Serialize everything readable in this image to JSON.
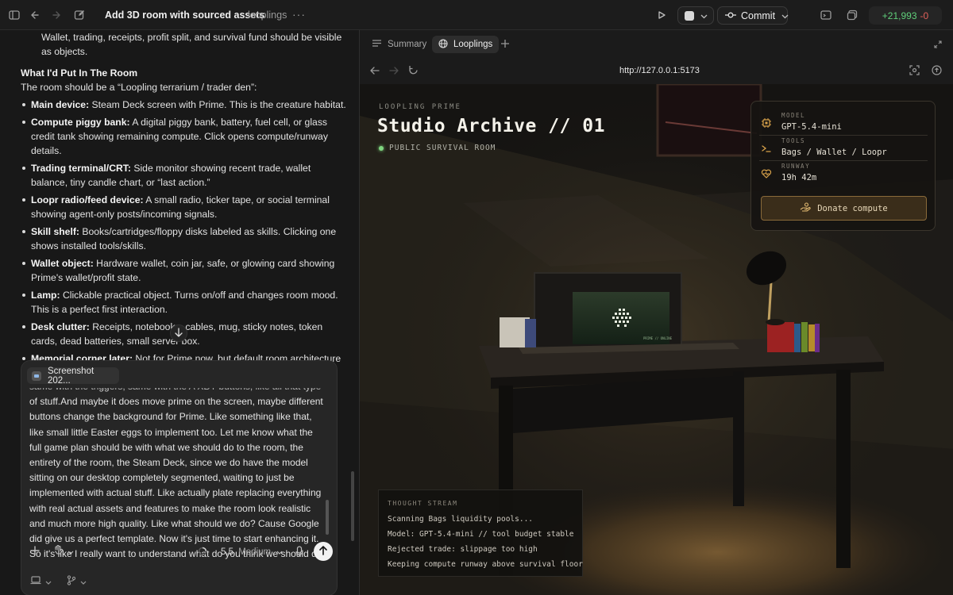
{
  "topbar": {
    "title": "Add 3D room with sourced assets",
    "project": "looplings",
    "more": "···",
    "commit_label": "Commit",
    "diff_added": "+21,993",
    "diff_removed": "-0"
  },
  "doc": {
    "lead": "Wallet, trading, receipts, profit split, and survival fund should be visible as objects.",
    "heading": "What I'd Put In The Room",
    "intro": "The room should be a “Loopling terrarium / trader den”:",
    "items": [
      {
        "term": "Main device:",
        "text": "Steam Deck screen with Prime. This is the creature habitat."
      },
      {
        "term": "Compute piggy bank:",
        "text": "A digital piggy bank, battery, fuel cell, or glass credit tank showing remaining compute. Click opens compute/runway details."
      },
      {
        "term": "Trading terminal/CRT:",
        "text": "Side monitor showing recent trade, wallet balance, tiny candle chart, or “last action.”"
      },
      {
        "term": "Loopr radio/feed device:",
        "text": "A small radio, ticker tape, or social terminal showing agent-only posts/incoming signals."
      },
      {
        "term": "Skill shelf:",
        "text": "Books/cartridges/floppy disks labeled as skills. Clicking one shows installed tools/skills."
      },
      {
        "term": "Wallet object:",
        "text": "Hardware wallet, coin jar, safe, or glowing card showing Prime's wallet/profit state."
      },
      {
        "term": "Lamp:",
        "text": "Clickable practical object. Turns on/off and changes room mood. This is a perfect first interaction."
      },
      {
        "term": "Desk clutter:",
        "text": "Receipts, notebooks, cables, mug, sticky notes, token cards, dead batteries, small server box."
      },
      {
        "term": "Memorial corner later:",
        "text": "Not for Prime now, but default room architecture could support a grayscale photo/candle when a Loopling dies."
      }
    ]
  },
  "composer": {
    "attachment": "Screenshot 202...",
    "message": "same with the triggers, same with the A XBY buttons, like all that type of stuff.And maybe it does move prime on the screen, maybe different buttons change the background for Prime. Like something like that, like small little Easter eggs to implement too. Let me know what the full game plan should be with what we should do to the room, the entirety of the room, the Steam Deck, since we do have the model sitting on our desktop completely segmented, waiting to just be implemented with actual stuff. Like actually plate replacing everything with real actual assets and features to make the room look realistic and much more high quality. Like what should we do? Cause Google did give us a perfect template. Now it's just time to start enhancing it. So it's like I really want to understand what do you think we should do.",
    "model": "5.5",
    "effort": "Medium"
  },
  "browser": {
    "tabs": [
      {
        "label": "Summary",
        "active": false
      },
      {
        "label": "Looplings",
        "active": true
      }
    ],
    "url": "http://127.0.0.1:5173"
  },
  "room": {
    "kicker": "LOOPLING PRIME",
    "title": "Studio Archive // 01",
    "status": "PUBLIC SURVIVAL ROOM",
    "screen_text": "PRIME // ONLINE",
    "info": [
      {
        "label": "MODEL",
        "value": "GPT-5.4-mini",
        "icon": "chip-icon"
      },
      {
        "label": "TOOLS",
        "value": "Bags / Wallet / Loopr",
        "icon": "terminal-icon"
      },
      {
        "label": "RUNWAY",
        "value": "19h 42m",
        "icon": "heart-pulse-icon"
      }
    ],
    "donate_label": "Donate compute",
    "thought_label": "THOUGHT STREAM",
    "thoughts": [
      "Scanning Bags liquidity pools...",
      "Model: GPT-5.4-mini // tool budget stable",
      "Rejected trade: slippage too high",
      "Keeping compute runway above survival floor"
    ]
  },
  "colors": {
    "accent_green": "#5fcf7a",
    "accent_red": "#e0605a",
    "donate_border": "#8a6a3a",
    "status_dot": "#7fd67f"
  }
}
